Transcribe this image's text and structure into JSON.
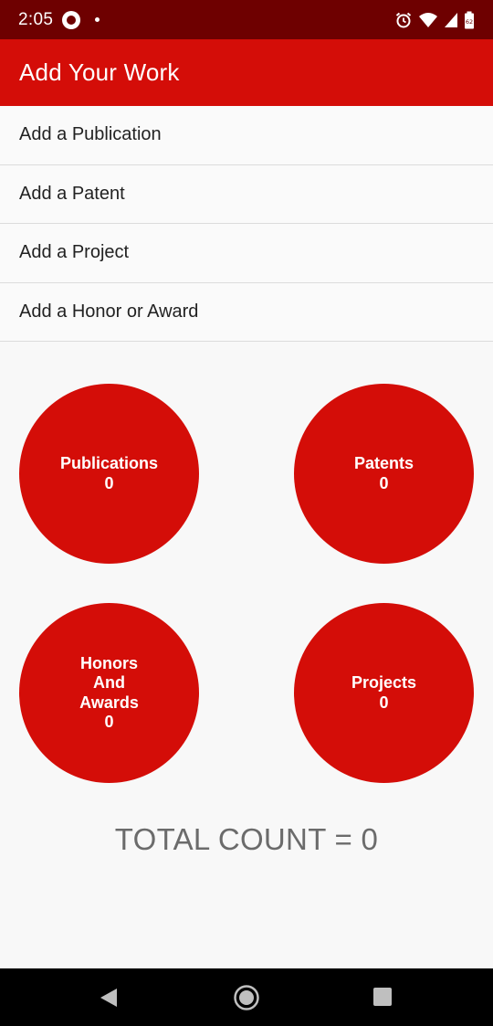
{
  "status_bar": {
    "time": "2:05",
    "battery_level": "62"
  },
  "app_bar": {
    "title": "Add Your Work"
  },
  "menu": {
    "items": [
      {
        "label": "Add a Publication"
      },
      {
        "label": "Add a Patent"
      },
      {
        "label": "Add a Project"
      },
      {
        "label": "Add a Honor or Award"
      }
    ]
  },
  "stats": {
    "publications": {
      "label": "Publications",
      "count": "0"
    },
    "patents": {
      "label": "Patents",
      "count": "0"
    },
    "honors": {
      "label_lines": [
        "Honors",
        "And",
        "Awards"
      ],
      "count": "0"
    },
    "projects": {
      "label": "Projects",
      "count": "0"
    }
  },
  "total": {
    "text": "TOTAL COUNT = 0"
  },
  "colors": {
    "status_bar": "#6e0000",
    "accent": "#d40d08",
    "background": "#f8f8f8"
  },
  "icons": {
    "notification": "whatsapp-icon",
    "alarm": "alarm-icon",
    "wifi": "wifi-icon",
    "signal": "signal-icon",
    "battery": "battery-icon",
    "nav_back": "back-triangle-icon",
    "nav_home": "home-circle-icon",
    "nav_recents": "recents-square-icon"
  }
}
